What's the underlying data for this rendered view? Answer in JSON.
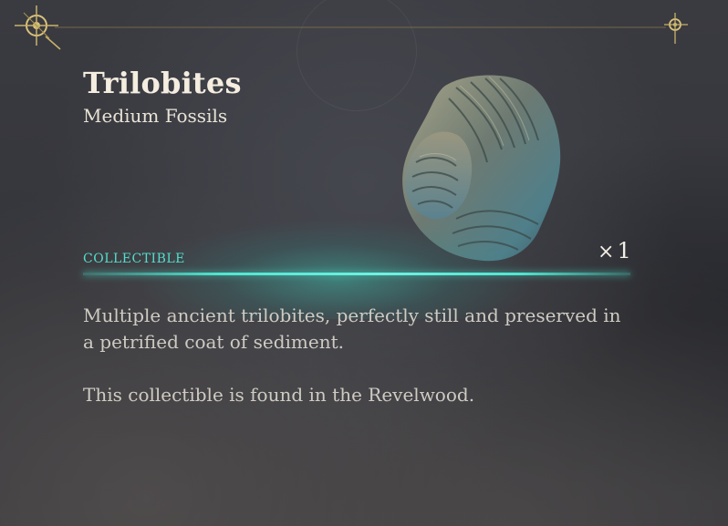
{
  "item": {
    "title": "Trilobites",
    "subtitle": "Medium Fossils",
    "category": "COLLECTIBLE",
    "quantity_prefix": "×",
    "quantity": "1",
    "image_icon": "trilobite-fossil-icon"
  },
  "description": {
    "paragraph_1": "Multiple ancient trilobites, perfectly still and preserved in a petrified coat of sediment.",
    "paragraph_2": "This collectible is found in the Revelwood."
  },
  "colors": {
    "accent": "#54ddcc",
    "title": "#f4ede0",
    "body_text": "#cfcbc3",
    "ornament_gold": "#d9c27a",
    "background": "#36373c"
  }
}
